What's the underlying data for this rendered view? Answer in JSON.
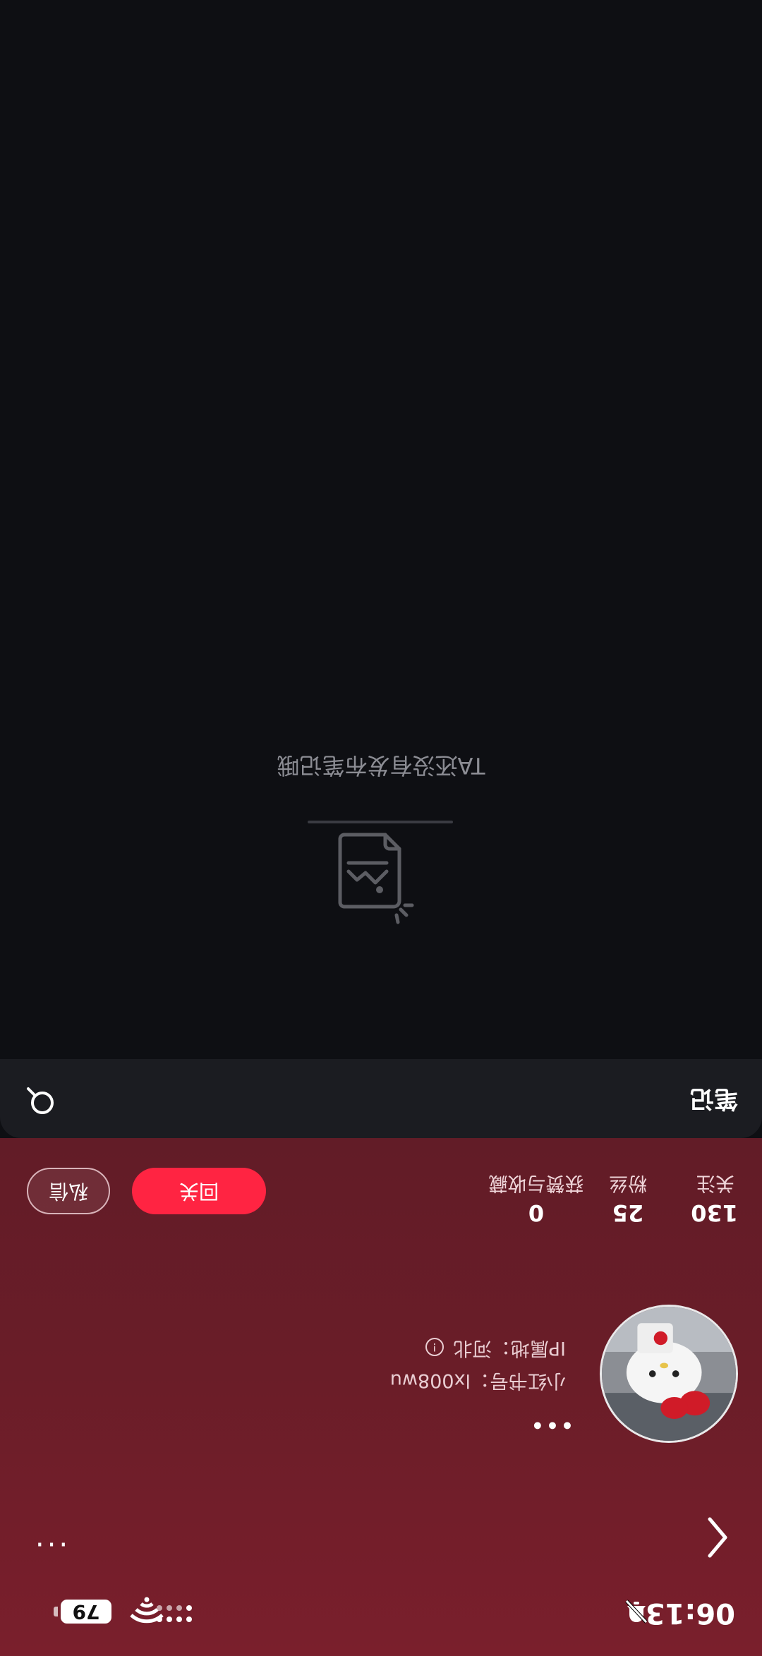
{
  "status_bar": {
    "time": "06:13",
    "battery": "79"
  },
  "profile": {
    "redbook_id": "小红书号：lx008wu",
    "ip_location": "IP属地：河北"
  },
  "stats": {
    "following_count": "130",
    "following_label": "关注",
    "fans_count": "25",
    "fans_label": "粉丝",
    "likes_count": "0",
    "likes_label": "获赞与收藏"
  },
  "actions": {
    "follow_back": "回关",
    "message": "私信"
  },
  "tabs": {
    "notes": "笔记"
  },
  "empty": {
    "text": "TA还没有发布笔记哦"
  },
  "colors": {
    "accent": "#ff2442",
    "header_bg": "#6a1d28",
    "page_bg": "#0e0f13"
  }
}
